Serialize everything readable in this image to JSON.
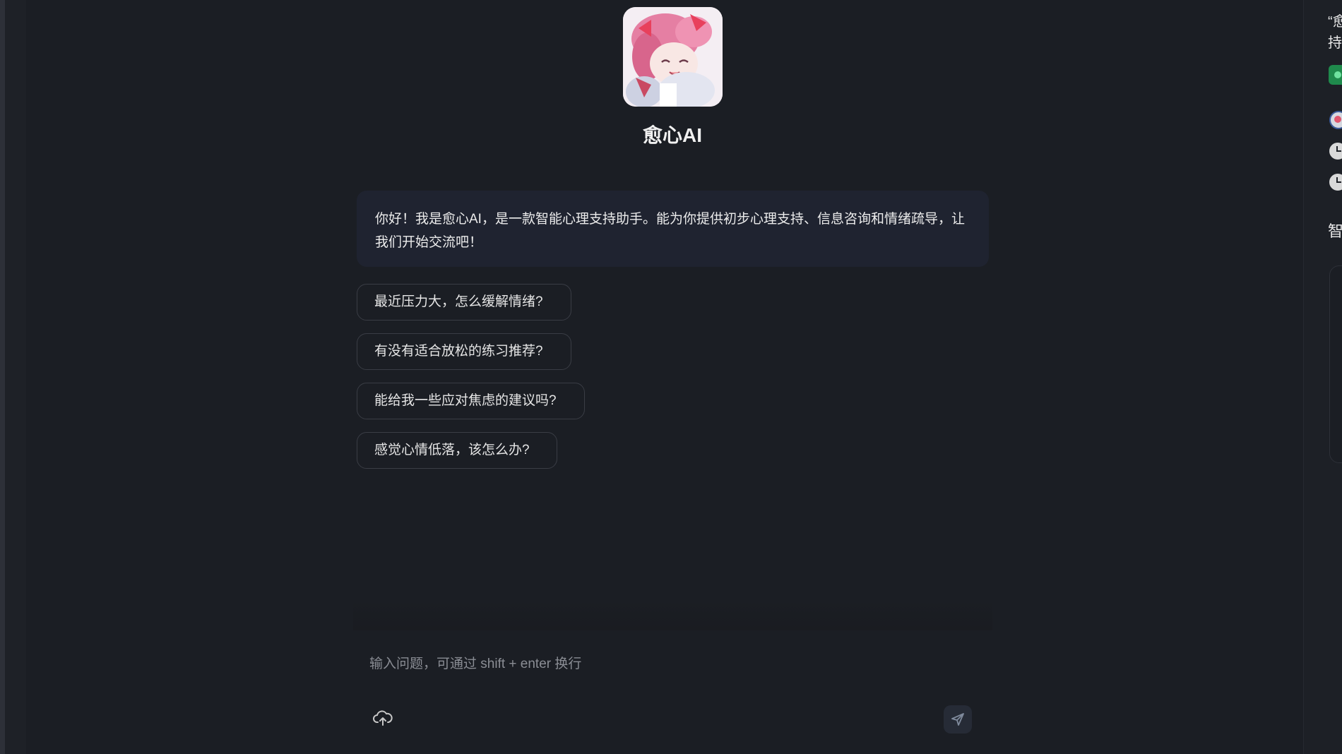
{
  "bot": {
    "name": "愈心AI",
    "avatar_icon": "anime-girl-avatar"
  },
  "welcome_message": "你好！我是愈心AI，是一款智能心理支持助手。能为你提供初步心理支持、信息咨询和情绪疏导，让我们开始交流吧！",
  "suggestions": [
    "最近压力大，怎么缓解情绪?",
    "有没有适合放松的练习推荐?",
    "能给我一些应对焦虑的建议吗?",
    "感觉心情低落，该怎么办?"
  ],
  "input": {
    "placeholder": "输入问题，可通过 shift + enter 换行",
    "value": "",
    "upload_icon": "cloud-upload-icon",
    "send_icon": "send-icon"
  },
  "right_panel": {
    "line1": "“愈",
    "line2": "持",
    "section_char": "智"
  },
  "colors": {
    "background": "#1b1e24",
    "bubble": "#1f2330",
    "border": "#3a3d45",
    "accent_green": "#1f8a4c"
  }
}
